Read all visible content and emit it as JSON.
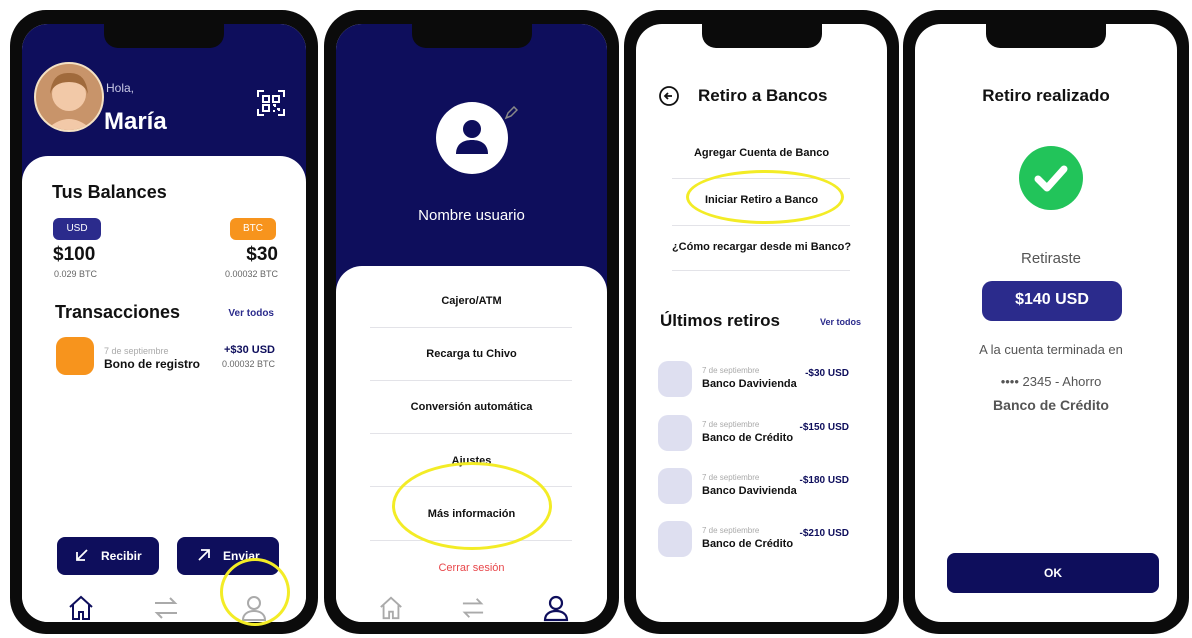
{
  "screen1": {
    "greeting": "Hola,",
    "name": "María",
    "balances_title": "Tus Balances",
    "usd_badge": "USD",
    "btc_badge": "BTC",
    "usd_amount": "$100",
    "usd_sub": "0.029 BTC",
    "btc_amount": "$30",
    "btc_sub": "0.00032 BTC",
    "transactions_title": "Transacciones",
    "view_all": "Ver todos",
    "transaction": {
      "date": "7 de septiembre",
      "title": "Bono de registro",
      "amount": "+$30 USD",
      "sub": "0.00032 BTC"
    },
    "receive_label": "Recibir",
    "send_label": "Enviar",
    "icons": [
      "qr-scan-icon",
      "home-icon",
      "transfer-icon",
      "profile-icon",
      "arrow-down-left-icon",
      "arrow-up-right-icon"
    ]
  },
  "screen2": {
    "username": "Nombre usuario",
    "menu": [
      "Cajero/ATM",
      "Recarga tu Chivo",
      "Conversión automática",
      "Ajustes",
      "Más información"
    ],
    "logout": "Cerrar sesión",
    "icons": [
      "user-avatar-icon",
      "edit-pencil-icon",
      "home-icon",
      "transfer-icon",
      "profile-icon"
    ]
  },
  "screen3": {
    "title": "Retiro a Bancos",
    "options": [
      "Agregar Cuenta de Banco",
      "Iniciar Retiro a Banco",
      "¿Cómo recargar desde mi Banco?"
    ],
    "recent_title": "Últimos retiros",
    "view_all": "Ver todos",
    "withdrawals": [
      {
        "date": "7 de septiembre",
        "bank": "Banco Davivienda",
        "amount": "-$30 USD"
      },
      {
        "date": "7 de septiembre",
        "bank": "Banco de Crédito",
        "amount": "-$150 USD"
      },
      {
        "date": "7 de septiembre",
        "bank": "Banco Davivienda",
        "amount": "-$180 USD"
      },
      {
        "date": "7 de septiembre",
        "bank": "Banco de Crédito",
        "amount": "-$210 USD"
      }
    ],
    "icons": [
      "back-arrow-icon"
    ]
  },
  "screen4": {
    "title": "Retiro realizado",
    "withdrew_label": "Retiraste",
    "amount": "$140 USD",
    "account_label": "A la cuenta terminada en",
    "account_number": "•••• 2345 - Ahorro",
    "bank": "Banco de Crédito",
    "ok_label": "OK",
    "icons": [
      "success-check-icon"
    ]
  },
  "colors": {
    "navy": "#0e0e5c",
    "orange": "#f7941d",
    "usd_badge": "#2b2b8c",
    "green": "#22c45a",
    "highlight": "#f3ec26",
    "logout_red": "#e8474b"
  }
}
